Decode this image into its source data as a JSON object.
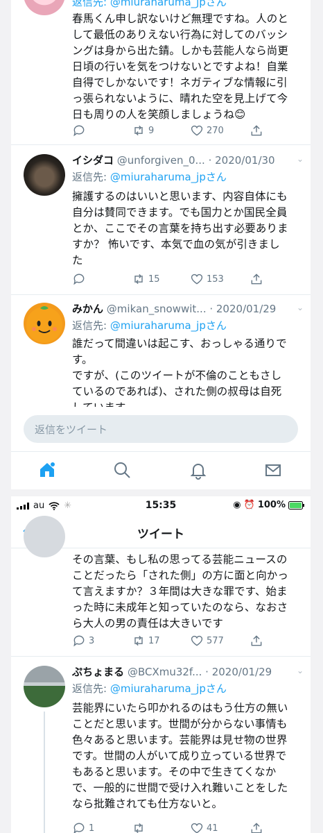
{
  "top_card": {
    "partial_reply_to": "返信先: @miuraharuma_jpさん",
    "tweet1": {
      "body": "春馬くん申し訳ないけど無理ですね。人のと\nして最低のありえない行為に対してのバッシ\nングは身から出た錆。しかも芸能人なら尚更\n日頃の行いを気をつけないとですよね！自業\n自得でしかないです！ネガティブな情報に引\nっ張られないように、晴れた空を見上げて今\n日も周りの人を笑顔しましょうね😊",
      "retweets": "9",
      "likes": "270"
    },
    "tweet2": {
      "name": "イシダコ",
      "meta": "@unforgiven_0... · 2020/01/30",
      "reply_prefix": "返信先: ",
      "reply_handle": "@miuraharuma_jpさん",
      "body": "擁護するのはいいと思います、内容自体にも\n自分は賛同できます。でも国力とか国民全員\nとか、ここでその言葉を持ち出す必要ありま\nすか？ 怖いです、本気で血の気が引きまし\nた",
      "retweets": "15",
      "likes": "153"
    },
    "tweet3": {
      "name": "みかん",
      "meta": "@mikan_snowwit... · 2020/01/29",
      "reply_prefix": "返信先: ",
      "reply_handle": "@miuraharuma_jpさん",
      "body": "誰だって間違いは起こす、おっしゃる通りで\nす。\nですが、(このツイートが不倫のこともさし\nているのであれば)、された側の叔母は自死\nしています。"
    },
    "reply_placeholder": "返信をツイート"
  },
  "bottom_card": {
    "status": {
      "carrier": "au",
      "time": "15:35",
      "battery": "100%"
    },
    "nav_title": "ツイート",
    "tweet4": {
      "body": "その言葉、もし私の思ってる芸能ニュースの\nことだったら「された側」の方に面と向かっ\nて言えますか？３年間は大きな罪です、始ま\nった時に未成年と知っていたのなら、なおさ\nら大人の男の責任は大きいです",
      "replies": "3",
      "retweets": "17",
      "likes": "577"
    },
    "tweet5": {
      "name": "ぷちょまる",
      "meta": "@BCXmu32f... · 2020/01/29",
      "reply_prefix": "返信先: ",
      "reply_handle": "@miuraharuma_jpさん",
      "body": "芸能界にいたら叩かれるのはもう仕方の無い\nことだと思います。世間が分からない事情も\n色々あると思います。芸能界は見せ物の世界\nです。世間の人がいて成り立っている世界で\nもあると思います。その中で生きてくなか\nで、一般的に世間で受け入れ難いことをした\nなら批難されても仕方ないと。",
      "replies": "1",
      "likes": "41"
    }
  },
  "colors": {
    "link": "#1da1f2",
    "muted": "#657786",
    "divider": "#e6ecf0",
    "battery_green": "#4cd964"
  },
  "icons": [
    "reply-icon",
    "retweet-icon",
    "like-icon",
    "share-icon",
    "home-icon",
    "search-icon",
    "notifications-icon",
    "messages-icon",
    "back-chevron-icon",
    "wifi-icon",
    "signal-icon",
    "battery-icon",
    "alarm-icon",
    "location-icon"
  ]
}
